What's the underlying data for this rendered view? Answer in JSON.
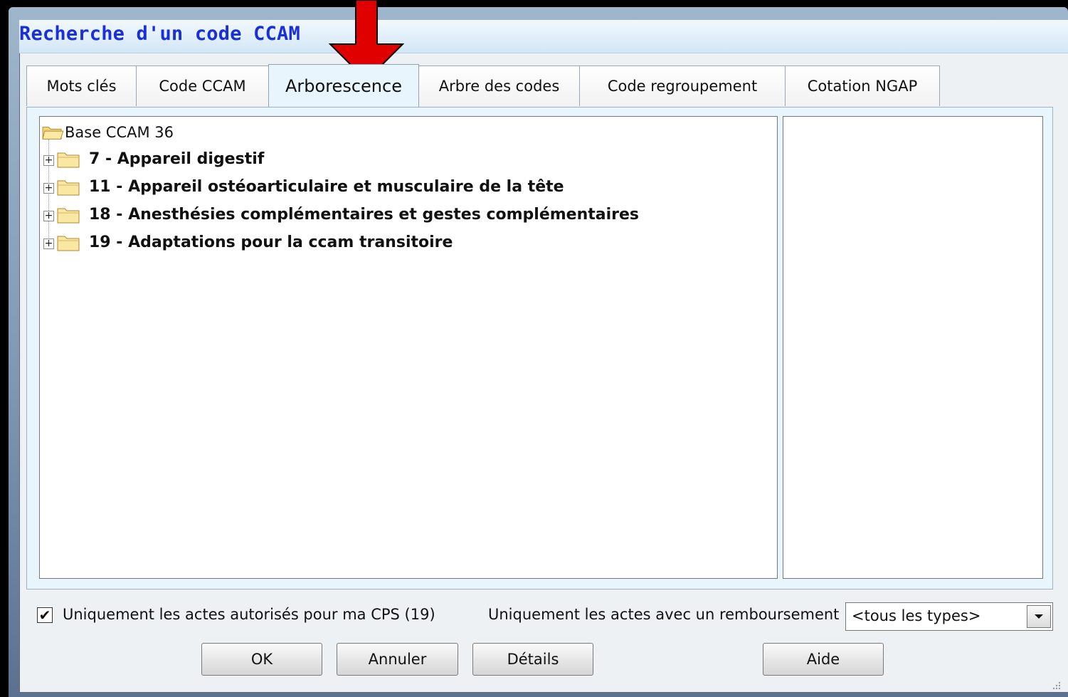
{
  "window": {
    "title": "Recherche d'un code CCAM"
  },
  "tabs": [
    {
      "label": "Mots clés"
    },
    {
      "label": "Code CCAM"
    },
    {
      "label": "Arborescence",
      "active": true
    },
    {
      "label": "Arbre des codes"
    },
    {
      "label": "Code regroupement"
    },
    {
      "label": "Cotation NGAP"
    }
  ],
  "tree": {
    "root": "Base CCAM 36",
    "nodes": [
      {
        "label": "7 - Appareil digestif"
      },
      {
        "label": "11 - Appareil ostéoarticulaire et musculaire de la tête"
      },
      {
        "label": "18 - Anesthésies complémentaires et gestes complémentaires"
      },
      {
        "label": "19 - Adaptations pour la ccam transitoire"
      }
    ],
    "expander_glyph": "+"
  },
  "filters": {
    "cps_checkbox": {
      "label": "Uniquement les actes autorisés pour ma CPS (19)",
      "checked": true,
      "mark": "✔"
    },
    "refund": {
      "label": "Uniquement les actes avec un remboursement :",
      "value": "<tous les types>"
    }
  },
  "buttons": {
    "ok": "OK",
    "cancel": "Annuler",
    "details": "Détails",
    "help": "Aide"
  },
  "colors": {
    "title": "#1a2fd8",
    "panel": "#e8f5fd",
    "arrow": "#e00000"
  },
  "icons": {
    "folder": "folder-icon",
    "arrow": "red-down-arrow-icon",
    "dropdown": "chevron-down-icon"
  }
}
